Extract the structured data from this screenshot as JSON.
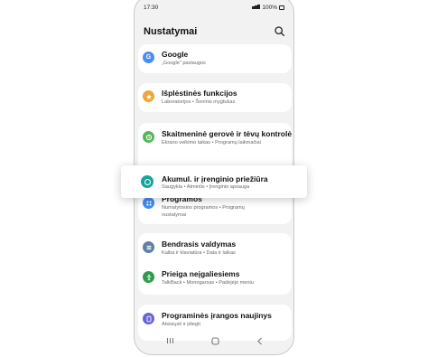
{
  "status": {
    "time": "17:30",
    "battery": "100%"
  },
  "header": {
    "title": "Nustatymai",
    "search_icon": "search-icon"
  },
  "items": [
    {
      "title": "Google",
      "sub": "„Google“ paslaugos",
      "icon": "google-icon",
      "icon_letter": "G",
      "color": "#4c8ef0"
    },
    {
      "title": "Išplėstinės funkcijos",
      "sub": "Laboratorijos  •  Šoninis mygtukas",
      "icon": "star-plus-icon",
      "color": "#f0a537"
    },
    {
      "title": "Skaitmeninė gerovė ir tėvų kontrolė",
      "sub": "Ekrano veikimo laikas  •  Programų laikmačiai",
      "icon": "wellbeing-icon",
      "color": "#58b65a"
    },
    {
      "title": "Programos",
      "sub": "Numatytosios programos  •  Programų",
      "sub2": "nustatymai",
      "icon": "apps-icon",
      "color": "#3f8df0"
    },
    {
      "title": "Bendrasis valdymas",
      "sub": "Kalba ir klaviatūra  •  Data ir laikas",
      "icon": "sliders-icon",
      "color": "#5f7fa6"
    },
    {
      "title": "Prieiga neįgaliesiems",
      "sub": "TalkBack  •  Monogarsas  •  Padėjėjo meniu",
      "icon": "accessibility-icon",
      "color": "#2f9b4c"
    },
    {
      "title": "Programinės įrangos naujinys",
      "sub": "Atsisiųsti ir įdiegti",
      "icon": "software-update-icon",
      "color": "#6a63d6"
    }
  ],
  "popup": {
    "title": "Akumul. ir įrenginio priežiūra",
    "sub": "Saugykla  •  Atmintis  •  Įrenginio apsauga",
    "icon": "device-care-icon",
    "color": "#1aa39a"
  },
  "nav": {
    "recents": "recents-icon",
    "home": "home-icon",
    "back": "back-icon"
  }
}
